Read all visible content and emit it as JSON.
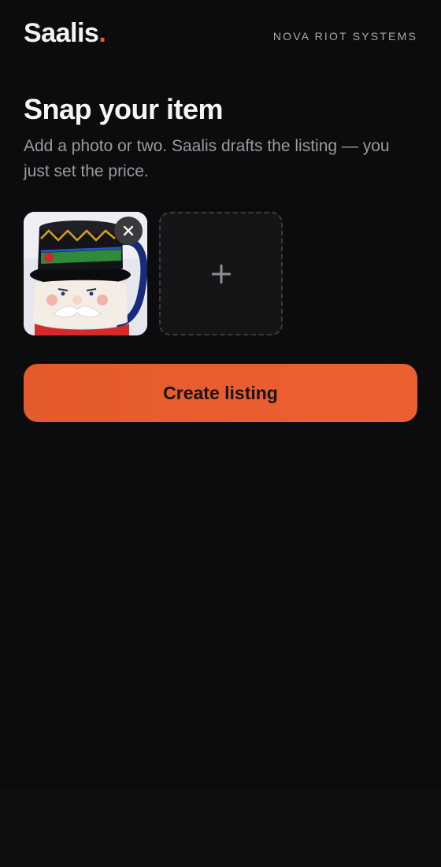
{
  "header": {
    "logo_text": "Saalis",
    "logo_dot": ".",
    "company": "NOVA RIOT SYSTEMS"
  },
  "main": {
    "title": "Snap your item",
    "subtitle": "Add a photo or two. Saalis drafts the listing — you just set the price.",
    "photos": [
      {
        "icon": "mug-photo",
        "remove_icon": "close-icon"
      }
    ],
    "add_photo_icon": "plus-icon",
    "cta_label": "Create listing"
  },
  "colors": {
    "accent": "#e85a2c",
    "background": "#0c0c0e",
    "muted_text": "#9a9aa0"
  }
}
